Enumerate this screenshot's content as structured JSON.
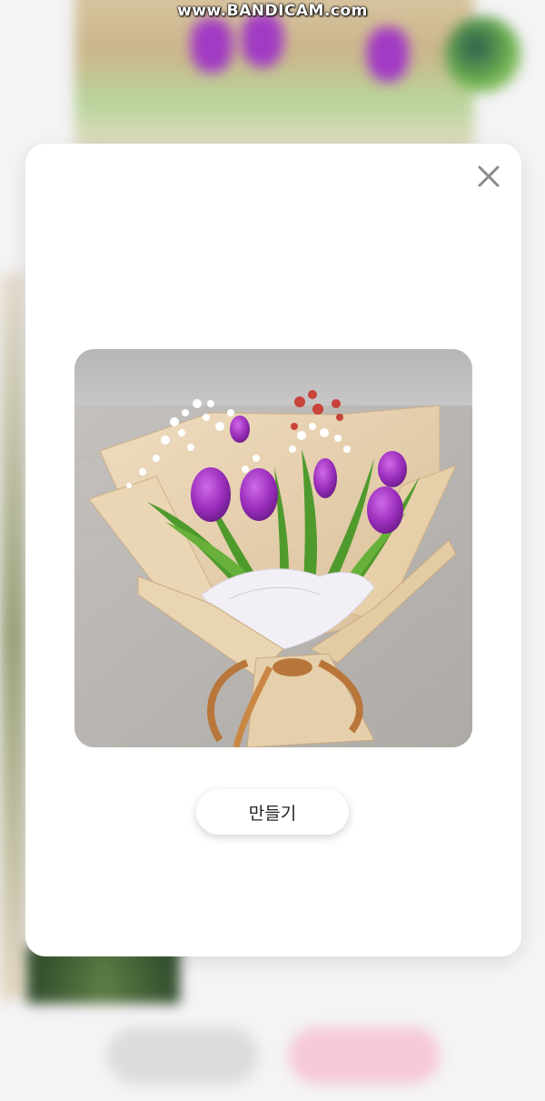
{
  "watermark": {
    "text": "www.BANDICAM.com"
  },
  "modal": {
    "close_icon": "close-icon",
    "image_alt": "tulip-bouquet-photo",
    "make_button_label": "만들기"
  },
  "background": {
    "caption_text": "",
    "left_button_label": "",
    "right_button_label": ""
  },
  "colors": {
    "modal_bg": "#ffffff",
    "accent_pink": "#f6c9d6",
    "tulip_purple": "#a23bc4",
    "wrap_paper": "#e8d4b3"
  }
}
